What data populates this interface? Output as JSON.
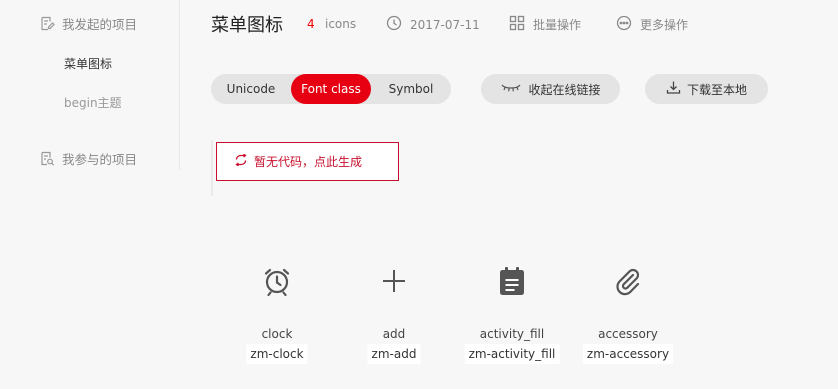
{
  "sidebar": {
    "my_projects": "我发起的项目",
    "items": [
      {
        "label": "菜单图标",
        "active": true
      },
      {
        "label": "begin主题",
        "active": false
      }
    ],
    "joined_projects": "我参与的项目"
  },
  "header": {
    "title": "菜单图标",
    "count": "4",
    "count_unit": "icons",
    "date": "2017-07-11",
    "batch": "批量操作",
    "more": "更多操作"
  },
  "tabs": [
    {
      "label": "Unicode",
      "active": false
    },
    {
      "label": "Font class",
      "active": true
    },
    {
      "label": "Symbol",
      "active": false
    }
  ],
  "actions": {
    "collapse_link": "收起在线链接",
    "download": "下载至本地"
  },
  "code": {
    "generate": "暂无代码，点此生成"
  },
  "icons": [
    {
      "name": "clock",
      "cls": "zm-clock",
      "icon": "clock-icon"
    },
    {
      "name": "add",
      "cls": "zm-add",
      "icon": "add-icon"
    },
    {
      "name": "activity_fill",
      "cls": "zm-activity_fill",
      "icon": "activity-fill-icon"
    },
    {
      "name": "accessory",
      "cls": "zm-accessory",
      "icon": "accessory-icon"
    }
  ],
  "colors": {
    "accent": "#e60012",
    "border_red": "#c8102e",
    "muted": "#888888",
    "background": "#f7f7f7"
  }
}
